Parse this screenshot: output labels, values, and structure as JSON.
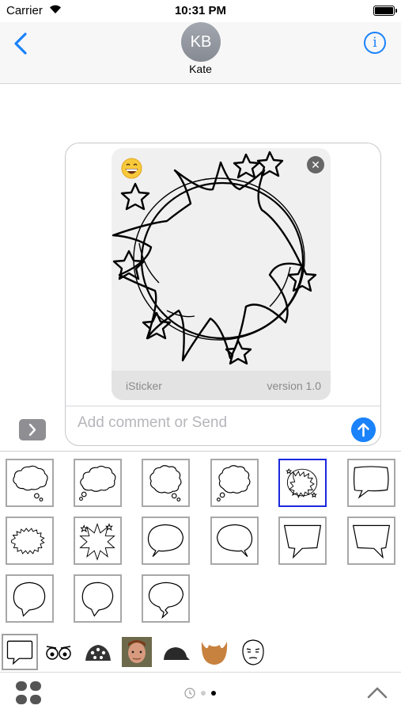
{
  "status_bar": {
    "carrier": "Carrier",
    "time": "10:31 PM"
  },
  "nav": {
    "back_icon": "chevron-left-icon",
    "avatar_initials": "KB",
    "contact_name": "Kate",
    "info_icon": "info-icon"
  },
  "compose": {
    "preview": {
      "brand": "iSticker",
      "version": "version 1.0",
      "remove_icon": "close-icon",
      "emoji_icon": "grinning-face-icon",
      "sticker": "comic-burst-bubble-with-stars"
    },
    "placeholder": "Add comment or Send",
    "send_icon": "arrow-up-icon",
    "expand_icon": "chevron-right-icon"
  },
  "drawer": {
    "stickers": [
      {
        "name": "thought-bubble-1"
      },
      {
        "name": "thought-bubble-2"
      },
      {
        "name": "thought-bubble-3"
      },
      {
        "name": "thought-bubble-4"
      },
      {
        "name": "burst-bubble-stars",
        "selected": true
      },
      {
        "name": "rectangle-speech-bubble"
      },
      {
        "name": "spiky-shout-bubble"
      },
      {
        "name": "burst-bubble-sparkles"
      },
      {
        "name": "oval-speech-bubble-1"
      },
      {
        "name": "oval-speech-bubble-2"
      },
      {
        "name": "trapezoid-speech-bubble-1"
      },
      {
        "name": "trapezoid-speech-bubble-2"
      },
      {
        "name": "round-speech-bubble-1"
      },
      {
        "name": "round-speech-bubble-2"
      },
      {
        "name": "lightning-speech-bubble"
      }
    ],
    "categories": [
      {
        "name": "speech-bubble-category-icon",
        "selected": true
      },
      {
        "name": "eyes-category-icon"
      },
      {
        "name": "ladybug-category-icon"
      },
      {
        "name": "face-photo-category-icon"
      },
      {
        "name": "cap-category-icon"
      },
      {
        "name": "beard-category-icon"
      },
      {
        "name": "meme-face-category-icon"
      }
    ],
    "bottom_bar": {
      "apps_icon": "app-drawer-icon",
      "recent_icon": "clock-icon",
      "collapse_icon": "chevron-up-icon",
      "page_count": 3,
      "current_page": 3
    }
  },
  "colors": {
    "accent": "#1a82fb",
    "selected_border": "#1a28dd",
    "nav_bg": "#f7f7f8"
  }
}
